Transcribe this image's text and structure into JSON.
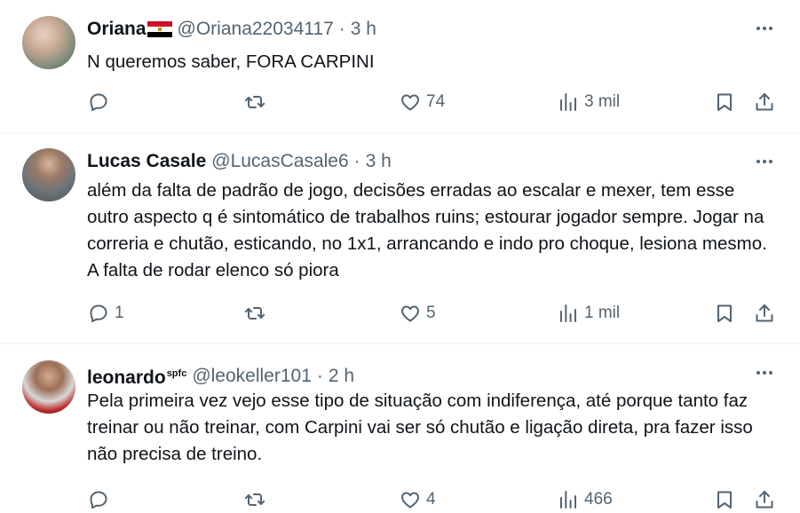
{
  "tweets": [
    {
      "name": "Oriana",
      "name_suffix": "",
      "handle": "@Oriana22034117",
      "time": "3 h",
      "text": "N queremos saber, FORA CARPINI",
      "replies": "",
      "likes": "74",
      "views": "3 mil"
    },
    {
      "name": "Lucas Casale",
      "name_suffix": "",
      "handle": "@LucasCasale6",
      "time": "3 h",
      "text": "além da falta de padrão de jogo, decisões erradas ao escalar e mexer, tem esse outro aspecto q é sintomático de trabalhos ruins; estourar jogador sempre. Jogar na correria e chutão, esticando, no 1x1, arrancando e indo pro choque, lesiona mesmo. A falta de rodar elenco só piora",
      "replies": "1",
      "likes": "5",
      "views": "1 mil"
    },
    {
      "name": "leonardo",
      "name_suffix": "spfc",
      "handle": "@leokeller101",
      "time": "2 h",
      "text": "Pela primeira vez vejo esse tipo de situação com indiferença, até porque tanto faz treinar ou não treinar, com Carpini vai ser só chutão e ligação direta, pra fazer isso não precisa de treino.",
      "replies": "",
      "likes": "4",
      "views": "466"
    }
  ],
  "separator": "·",
  "icons": [
    "reply-icon",
    "retweet-icon",
    "like-icon",
    "views-icon",
    "bookmark-icon",
    "share-icon",
    "more-icon",
    "flag-icon"
  ],
  "colors": {
    "text": "#0f1419",
    "muted": "#536471",
    "border": "#eff3f4"
  }
}
